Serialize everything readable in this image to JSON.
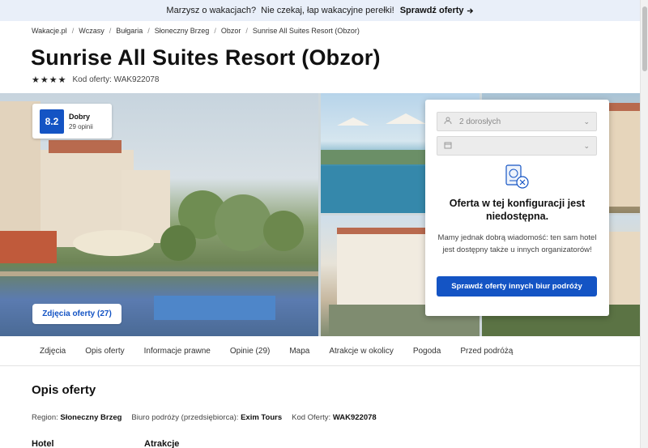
{
  "topbar": {
    "message": "Marzysz o wakacjach?  Nie czekaj, łap wakacyjne perełki! ",
    "link": "Sprawdź oferty",
    "link_icon": "arrow-right-icon"
  },
  "breadcrumbs": [
    "Wakacje.pl",
    "Wczasy",
    "Bułgaria",
    "Słoneczny Brzeg",
    "Obzor",
    "Sunrise All Suites Resort (Obzor)"
  ],
  "hotel": {
    "title": "Sunrise All Suites Resort (Obzor)",
    "stars": 4,
    "offer_code_label": "Kod oferty: WAK922078"
  },
  "review": {
    "score": "8.2",
    "label": "Dobry",
    "opinions": "29 opinii"
  },
  "gallery": {
    "photos_button": "Zdjęcia oferty (27)"
  },
  "booking_panel": {
    "travellers": "2 dorosłych",
    "date": "",
    "unavailable_title": "Oferta w tej konfiguracji jest niedostępna.",
    "unavailable_desc": "Mamy jednak dobrą wiadomość: ten sam hotel jest dostępny także u innych organizatorów!",
    "cta": "Sprawdź oferty innych biur podróży"
  },
  "tabs": [
    "Zdjęcia",
    "Opis oferty",
    "Informacje prawne",
    "Opinie (29)",
    "Mapa",
    "Atrakcje w okolicy",
    "Pogoda",
    "Przed podróżą"
  ],
  "description": {
    "title": "Opis oferty",
    "region_label": "Region:",
    "region_value": "Słoneczny Brzeg",
    "agency_label": "Biuro podróży (przedsiębiorca):",
    "agency_value": "Exim Tours",
    "code_label": "Kod Oferty:",
    "code_value": "WAK922078",
    "bottom_heading_1": "Hotel",
    "bottom_heading_2": "Atrakcje"
  },
  "colors": {
    "brand_blue": "#1454c4",
    "topbar_bg": "#e9eff9"
  }
}
